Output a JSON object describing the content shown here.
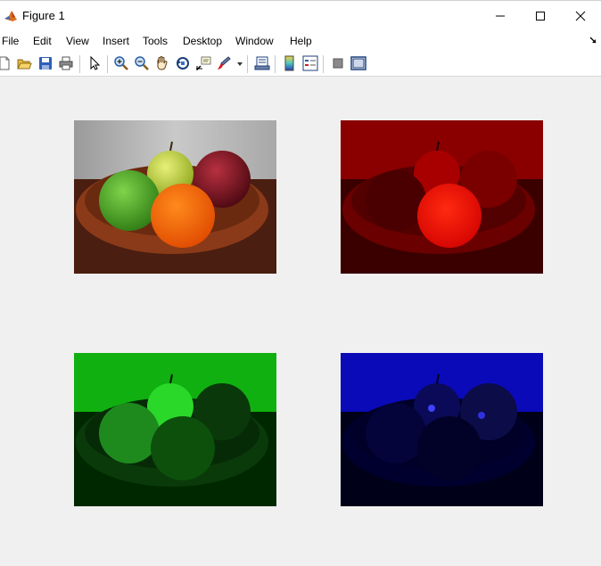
{
  "window": {
    "title": "Figure 1"
  },
  "menu": [
    "File",
    "Edit",
    "View",
    "Insert",
    "Tools",
    "Desktop",
    "Window",
    "Help"
  ],
  "toolbar": {
    "icons": [
      "new-figure-icon",
      "open-file-icon",
      "save-icon",
      "print-icon",
      "pointer-icon",
      "zoom-in-icon",
      "zoom-out-icon",
      "pan-hand-icon",
      "rotate-3d-icon",
      "data-cursor-icon",
      "brush-icon",
      "link-plot-icon",
      "colorbar-icon",
      "legend-icon",
      "hide-plot-tools-icon",
      "show-plot-tools-icon"
    ]
  },
  "axes": [
    {
      "channel": "rgb"
    },
    {
      "channel": "red"
    },
    {
      "channel": "green"
    },
    {
      "channel": "blue"
    }
  ],
  "colors": {
    "red_channel": "#ff0000",
    "green_channel": "#00ff00",
    "blue_channel": "#0000ff",
    "background": "#f0f0f0"
  }
}
